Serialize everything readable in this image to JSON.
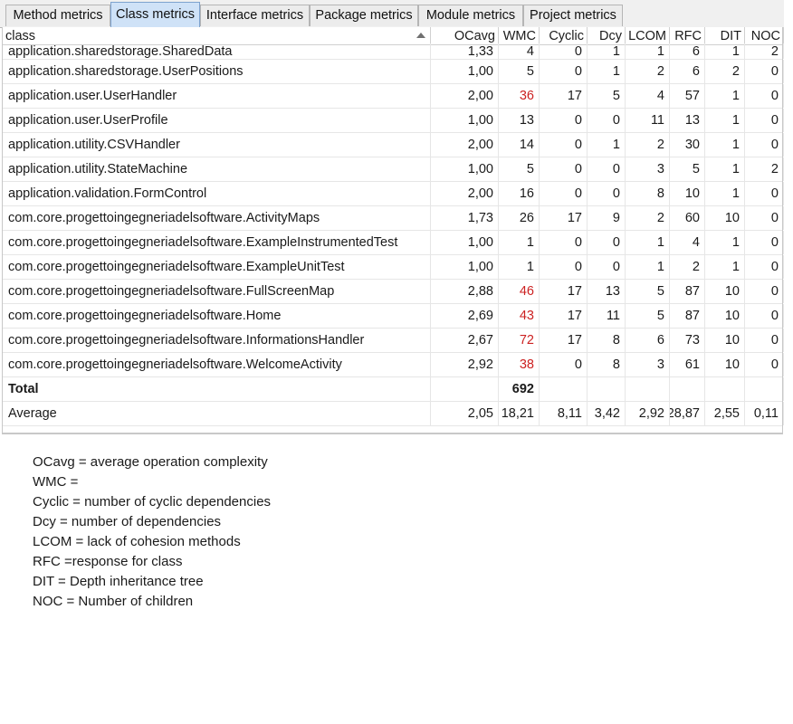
{
  "tabs": [
    {
      "label": "Method metrics",
      "active": false
    },
    {
      "label": "Class metrics",
      "active": true
    },
    {
      "label": "Interface metrics",
      "active": false
    },
    {
      "label": "Package metrics",
      "active": false
    },
    {
      "label": "Module metrics",
      "active": false
    },
    {
      "label": "Project metrics",
      "active": false
    }
  ],
  "table": {
    "columns": [
      "class",
      "OCavg",
      "WMC",
      "Cyclic",
      "Dcy",
      "LCOM",
      "RFC",
      "DIT",
      "NOC"
    ],
    "sort_column": "class",
    "sort_direction": "ascending",
    "highlight_color": "#cc2222",
    "rows": [
      {
        "class": "application.sharedstorage.SharedData",
        "OCavg": "1,33",
        "WMC": "4",
        "Cyclic": "0",
        "Dcy": "1",
        "LCOM": "1",
        "RFC": "6",
        "DIT": "1",
        "NOC": "2",
        "wmc_highlight": false
      },
      {
        "class": "application.sharedstorage.UserPositions",
        "OCavg": "1,00",
        "WMC": "5",
        "Cyclic": "0",
        "Dcy": "1",
        "LCOM": "2",
        "RFC": "6",
        "DIT": "2",
        "NOC": "0",
        "wmc_highlight": false
      },
      {
        "class": "application.user.UserHandler",
        "OCavg": "2,00",
        "WMC": "36",
        "Cyclic": "17",
        "Dcy": "5",
        "LCOM": "4",
        "RFC": "57",
        "DIT": "1",
        "NOC": "0",
        "wmc_highlight": true
      },
      {
        "class": "application.user.UserProfile",
        "OCavg": "1,00",
        "WMC": "13",
        "Cyclic": "0",
        "Dcy": "0",
        "LCOM": "11",
        "RFC": "13",
        "DIT": "1",
        "NOC": "0",
        "wmc_highlight": false
      },
      {
        "class": "application.utility.CSVHandler",
        "OCavg": "2,00",
        "WMC": "14",
        "Cyclic": "0",
        "Dcy": "1",
        "LCOM": "2",
        "RFC": "30",
        "DIT": "1",
        "NOC": "0",
        "wmc_highlight": false
      },
      {
        "class": "application.utility.StateMachine",
        "OCavg": "1,00",
        "WMC": "5",
        "Cyclic": "0",
        "Dcy": "0",
        "LCOM": "3",
        "RFC": "5",
        "DIT": "1",
        "NOC": "2",
        "wmc_highlight": false
      },
      {
        "class": "application.validation.FormControl",
        "OCavg": "2,00",
        "WMC": "16",
        "Cyclic": "0",
        "Dcy": "0",
        "LCOM": "8",
        "RFC": "10",
        "DIT": "1",
        "NOC": "0",
        "wmc_highlight": false
      },
      {
        "class": "com.core.progettoingegneriadelsoftware.ActivityMaps",
        "OCavg": "1,73",
        "WMC": "26",
        "Cyclic": "17",
        "Dcy": "9",
        "LCOM": "2",
        "RFC": "60",
        "DIT": "10",
        "NOC": "0",
        "wmc_highlight": false
      },
      {
        "class": "com.core.progettoingegneriadelsoftware.ExampleInstrumentedTest",
        "OCavg": "1,00",
        "WMC": "1",
        "Cyclic": "0",
        "Dcy": "0",
        "LCOM": "1",
        "RFC": "4",
        "DIT": "1",
        "NOC": "0",
        "wmc_highlight": false
      },
      {
        "class": "com.core.progettoingegneriadelsoftware.ExampleUnitTest",
        "OCavg": "1,00",
        "WMC": "1",
        "Cyclic": "0",
        "Dcy": "0",
        "LCOM": "1",
        "RFC": "2",
        "DIT": "1",
        "NOC": "0",
        "wmc_highlight": false
      },
      {
        "class": "com.core.progettoingegneriadelsoftware.FullScreenMap",
        "OCavg": "2,88",
        "WMC": "46",
        "Cyclic": "17",
        "Dcy": "13",
        "LCOM": "5",
        "RFC": "87",
        "DIT": "10",
        "NOC": "0",
        "wmc_highlight": true
      },
      {
        "class": "com.core.progettoingegneriadelsoftware.Home",
        "OCavg": "2,69",
        "WMC": "43",
        "Cyclic": "17",
        "Dcy": "11",
        "LCOM": "5",
        "RFC": "87",
        "DIT": "10",
        "NOC": "0",
        "wmc_highlight": true
      },
      {
        "class": "com.core.progettoingegneriadelsoftware.InformationsHandler",
        "OCavg": "2,67",
        "WMC": "72",
        "Cyclic": "17",
        "Dcy": "8",
        "LCOM": "6",
        "RFC": "73",
        "DIT": "10",
        "NOC": "0",
        "wmc_highlight": true
      },
      {
        "class": "com.core.progettoingegneriadelsoftware.WelcomeActivity",
        "OCavg": "2,92",
        "WMC": "38",
        "Cyclic": "0",
        "Dcy": "8",
        "LCOM": "3",
        "RFC": "61",
        "DIT": "10",
        "NOC": "0",
        "wmc_highlight": true
      }
    ],
    "total": {
      "class": "Total",
      "OCavg": "",
      "WMC": "692",
      "Cyclic": "",
      "Dcy": "",
      "LCOM": "",
      "RFC": "",
      "DIT": "",
      "NOC": ""
    },
    "average": {
      "class": "Average",
      "OCavg": "2,05",
      "WMC": "18,21",
      "Cyclic": "8,11",
      "Dcy": "3,42",
      "LCOM": "2,92",
      "RFC": "28,87",
      "DIT": "2,55",
      "NOC": "0,11"
    }
  },
  "legend": [
    "OCavg = average operation complexity",
    "WMC =",
    "Cyclic = number of cyclic dependencies",
    "Dcy = number of dependencies",
    "LCOM = lack of cohesion methods",
    "RFC =response for class",
    "DIT = Depth inheritance tree",
    "NOC = Number of children"
  ]
}
